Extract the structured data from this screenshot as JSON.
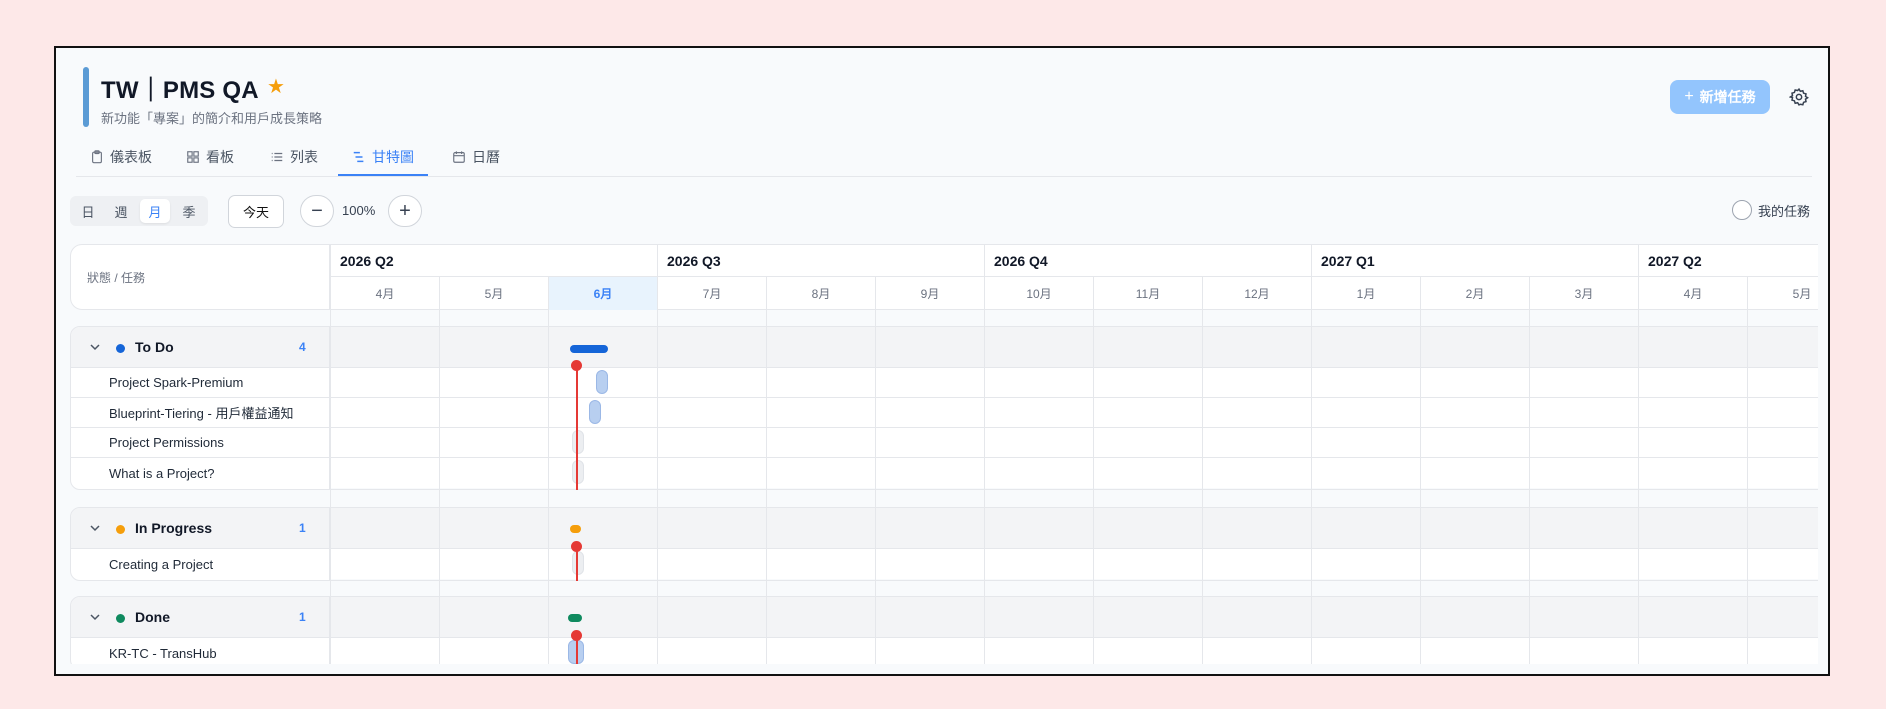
{
  "project": {
    "title": "TW｜PMS QA",
    "subtitle": "新功能「專案」的簡介和用戶成長策略",
    "starred": true
  },
  "header_actions": {
    "add_task_label": "新增任務",
    "settings_icon": "gear-icon"
  },
  "tabs": [
    {
      "label": "儀表板",
      "icon": "clipboard-icon",
      "active": false
    },
    {
      "label": "看板",
      "icon": "grid-icon",
      "active": false
    },
    {
      "label": "列表",
      "icon": "list-icon",
      "active": false
    },
    {
      "label": "甘特圖",
      "icon": "gantt-icon",
      "active": true
    },
    {
      "label": "日曆",
      "icon": "calendar-icon",
      "active": false
    }
  ],
  "toolbar": {
    "scales": [
      "日",
      "週",
      "月",
      "季"
    ],
    "active_scale": "月",
    "today_label": "今天",
    "zoom_label": "100%",
    "my_tasks_label": "我的任務"
  },
  "grid": {
    "left_header": "狀態 / 任務",
    "quarters": [
      "2026 Q2",
      "2026 Q3",
      "2026 Q4",
      "2027 Q1",
      "2027 Q2"
    ],
    "months": [
      "4月",
      "5月",
      "6月",
      "7月",
      "8月",
      "9月",
      "10月",
      "11月",
      "12月",
      "1月",
      "2月",
      "3月",
      "4月",
      "5月"
    ],
    "current_month_index": 2
  },
  "groups": [
    {
      "name": "To Do",
      "count": "4",
      "color": "#1565d8",
      "tasks": [
        "Project Spark-Premium",
        "Blueprint-Tiering - 用戶權益通知",
        "Project Permissions",
        "What is a Project?"
      ]
    },
    {
      "name": "In Progress",
      "count": "1",
      "color": "#f59e0b",
      "tasks": [
        "Creating a Project"
      ]
    },
    {
      "name": "Done",
      "count": "1",
      "color": "#0f8a5f",
      "tasks": [
        "KR-TC - TransHub"
      ]
    }
  ],
  "colors": {
    "accent": "#3b82f6",
    "today_marker": "#e53935",
    "task_bar": "#b8cff0",
    "task_bar_empty": "#e5e7eb"
  }
}
